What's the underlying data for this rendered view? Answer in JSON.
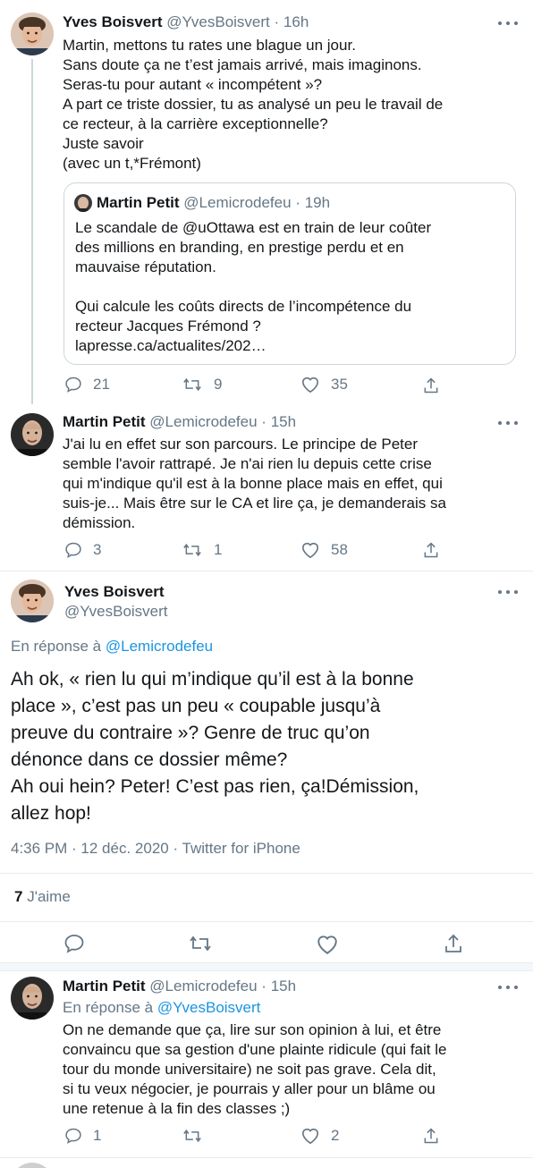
{
  "tweet1": {
    "name": "Yves Boisvert",
    "handle": "@YvesBoisvert",
    "time": "16h",
    "lines": [
      "Martin, mettons tu rates une blague un jour.",
      "Sans doute ça ne t’est jamais arrivé, mais imaginons.",
      "Seras-tu pour autant « incompétent »?",
      "A part ce triste dossier, tu as analysé un peu le travail de",
      "ce recteur, à la carrière exceptionnelle?",
      "Juste savoir",
      "(avec un t,*Frémont)"
    ],
    "quote": {
      "name": "Martin Petit",
      "handle": "@Lemicrodefeu",
      "time": "19h",
      "lines": [
        "Le scandale de @uOttawa est en train de leur coûter",
        "des millions en branding, en prestige perdu et en",
        "mauvaise réputation.",
        "",
        "Qui calcule les coûts directs de l’incompétence du",
        "recteur Jacques Frémond ?",
        " lapresse.ca/actualites/202…"
      ]
    },
    "replies": "21",
    "retweets": "9",
    "likes": "35"
  },
  "tweet2": {
    "name": "Martin Petit",
    "handle": "@Lemicrodefeu",
    "time": "15h",
    "lines": [
      "J'ai lu en effet sur son parcours.  Le principe de Peter",
      "semble l'avoir rattrapé.  Je n'ai rien lu depuis cette crise",
      "qui m'indique qu'il est à la bonne place mais en effet, qui",
      "suis-je... Mais être sur le CA et lire ça, je demanderais sa",
      "démission."
    ],
    "replies": "3",
    "retweets": "1",
    "likes": "58"
  },
  "main": {
    "name": "Yves Boisvert",
    "handle": "@YvesBoisvert",
    "reply_prefix": "En réponse à",
    "reply_to": "@Lemicrodefeu",
    "lines": [
      "Ah ok, « rien lu qui m’indique qu’il est à la bonne",
      "place », c’est pas un peu « coupable jusqu’à",
      "preuve du contraire »? Genre de truc qu’on",
      "dénonce dans ce dossier même?",
      "Ah oui hein? Peter! C’est pas rien, ça!Démission,",
      "allez hop!"
    ],
    "timestamp": "4:36 PM · 12 déc. 2020 · Twitter for iPhone",
    "likes_count": "7",
    "likes_label": "J'aime"
  },
  "tweet3": {
    "name": "Martin Petit",
    "handle": "@Lemicrodefeu",
    "time": "15h",
    "reply_prefix": "En réponse à",
    "reply_to": "@YvesBoisvert",
    "lines": [
      "On ne demande que ça, lire sur son opinion à lui, et être",
      "convaincu que sa gestion d'une plainte ridicule (qui fait le",
      "tour du monde universitaire) ne soit pas grave. Cela dit,",
      "si tu veux négocier, je pourrais y aller pour un blâme ou",
      "une retenue à la fin des classes ;)"
    ],
    "replies": "1",
    "likes": "2"
  },
  "colors": {
    "text": "#14171a",
    "muted": "#657786",
    "link": "#1b95e0",
    "border": "#ccd6dd"
  }
}
